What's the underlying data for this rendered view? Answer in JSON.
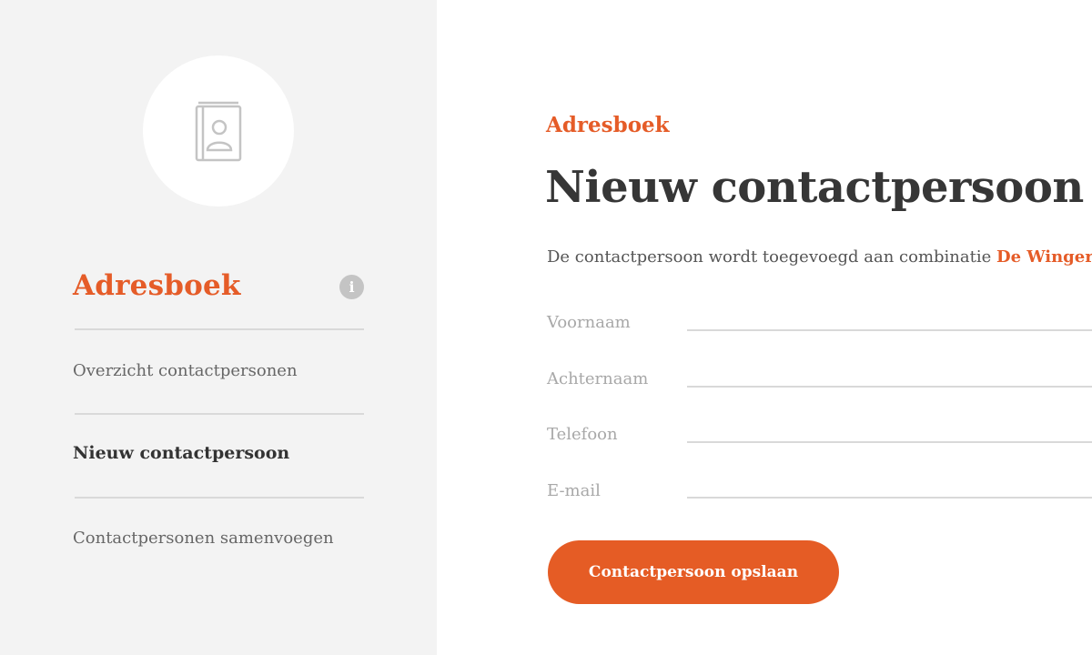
{
  "sidebar": {
    "logo_icon": "address-book-icon",
    "title": "Adresboek",
    "info_icon": "i",
    "nav": [
      {
        "label": "Overzicht contactpersonen",
        "active": false
      },
      {
        "label": "Nieuw contactpersoon",
        "active": true
      },
      {
        "label": "Contactpersonen samenvoegen",
        "active": false
      }
    ]
  },
  "main": {
    "breadcrumb": "Adresboek",
    "title": "Nieuw contactpersoon",
    "subtitle_prefix": "De contactpersoon wordt toegevoegd aan combinatie",
    "subtitle_combination": "De Wingerd",
    "fields": [
      {
        "label": "Voornaam",
        "value": ""
      },
      {
        "label": "Achternaam",
        "value": ""
      },
      {
        "label": "Telefoon",
        "value": ""
      },
      {
        "label": "E-mail",
        "value": ""
      }
    ],
    "save_label": "Contactpersoon opslaan"
  },
  "colors": {
    "accent": "#e55c28",
    "sidebar_bg": "#f3f3f3",
    "text_dark": "#363636",
    "muted": "#a8a8a8"
  }
}
